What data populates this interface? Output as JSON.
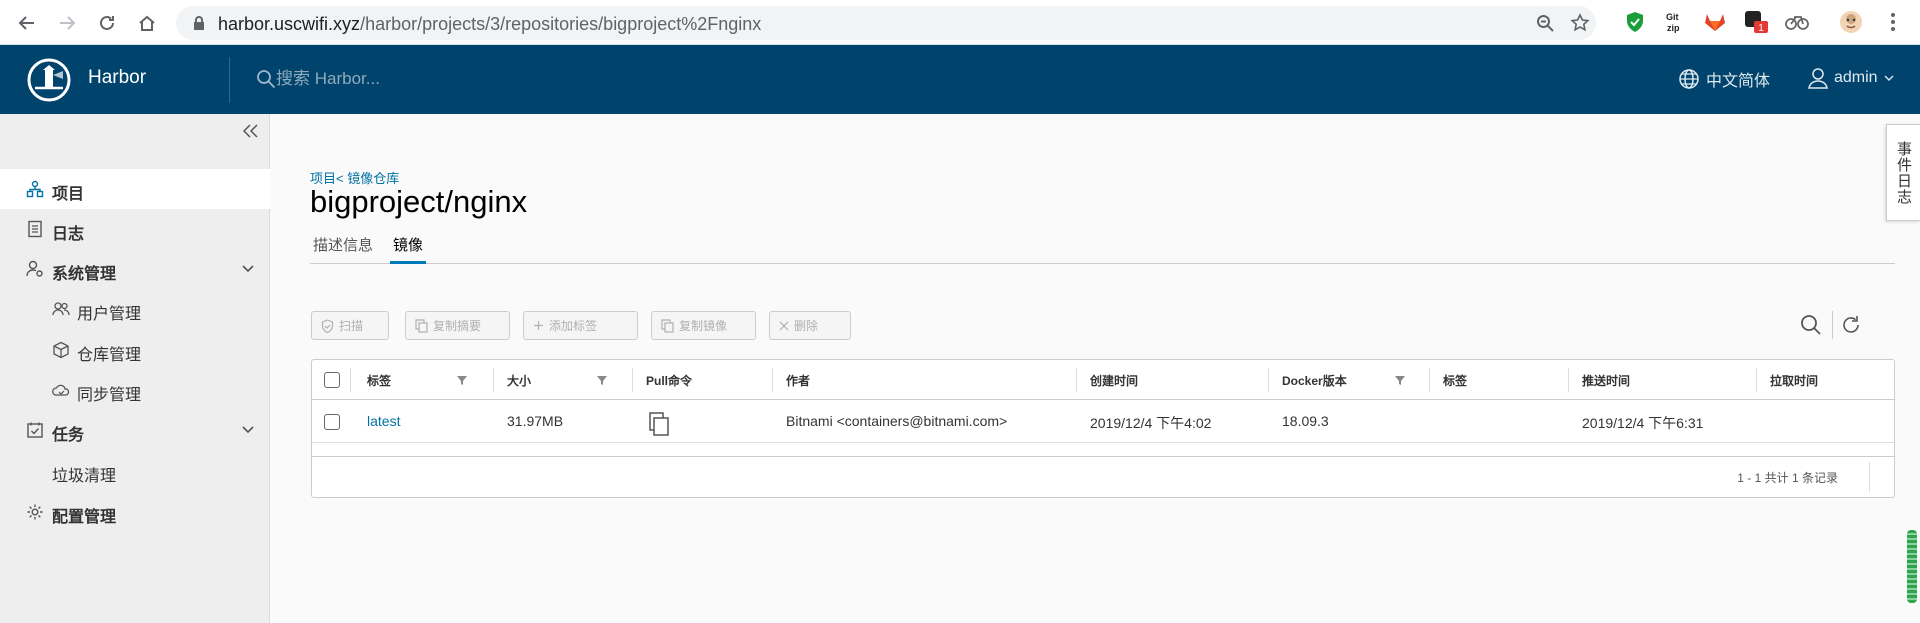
{
  "browser": {
    "url_host": "harbor.uscwifi.xyz",
    "url_path": "/harbor/projects/3/repositories/bigproject%2Fnginx",
    "extension_badge": "1"
  },
  "header": {
    "brand": "Harbor",
    "search_placeholder": "搜索 Harbor...",
    "language": "中文简体",
    "user": "admin"
  },
  "sidebar": {
    "items": [
      {
        "label": "项目",
        "icon": "projects-icon"
      },
      {
        "label": "日志",
        "icon": "logs-icon"
      },
      {
        "label": "系统管理",
        "icon": "admin-icon"
      },
      {
        "label": "用户管理",
        "icon": "users-icon"
      },
      {
        "label": "仓库管理",
        "icon": "registry-icon"
      },
      {
        "label": "同步管理",
        "icon": "replication-icon"
      },
      {
        "label": "任务",
        "icon": "tasks-icon"
      },
      {
        "label": "垃圾清理",
        "icon": ""
      },
      {
        "label": "配置管理",
        "icon": "gear-icon"
      }
    ]
  },
  "main": {
    "breadcrumb": "项目< 镜像仓库",
    "title": "bigproject/nginx",
    "tabs": [
      "描述信息",
      "镜像"
    ],
    "toolbar": {
      "scan": "扫描",
      "copy_digest": "复制摘要",
      "add_label": "添加标签",
      "copy_image": "复制镜像",
      "delete": "删除"
    },
    "table": {
      "headers": [
        "标签",
        "大小",
        "Pull命令",
        "作者",
        "创建时间",
        "Docker版本",
        "标签",
        "推送时间",
        "拉取时间"
      ],
      "rows": [
        {
          "tag": "latest",
          "size": "31.97MB",
          "author": "Bitnami <containers@bitnami.com>",
          "created": "2019/12/4 下午4:02",
          "docker_version": "18.09.3",
          "labels": "",
          "pushed": "2019/12/4 下午6:31",
          "pulled": ""
        }
      ],
      "pagination": "1 - 1 共计 1 条记录"
    }
  },
  "drawer": {
    "label": "事件日志"
  }
}
